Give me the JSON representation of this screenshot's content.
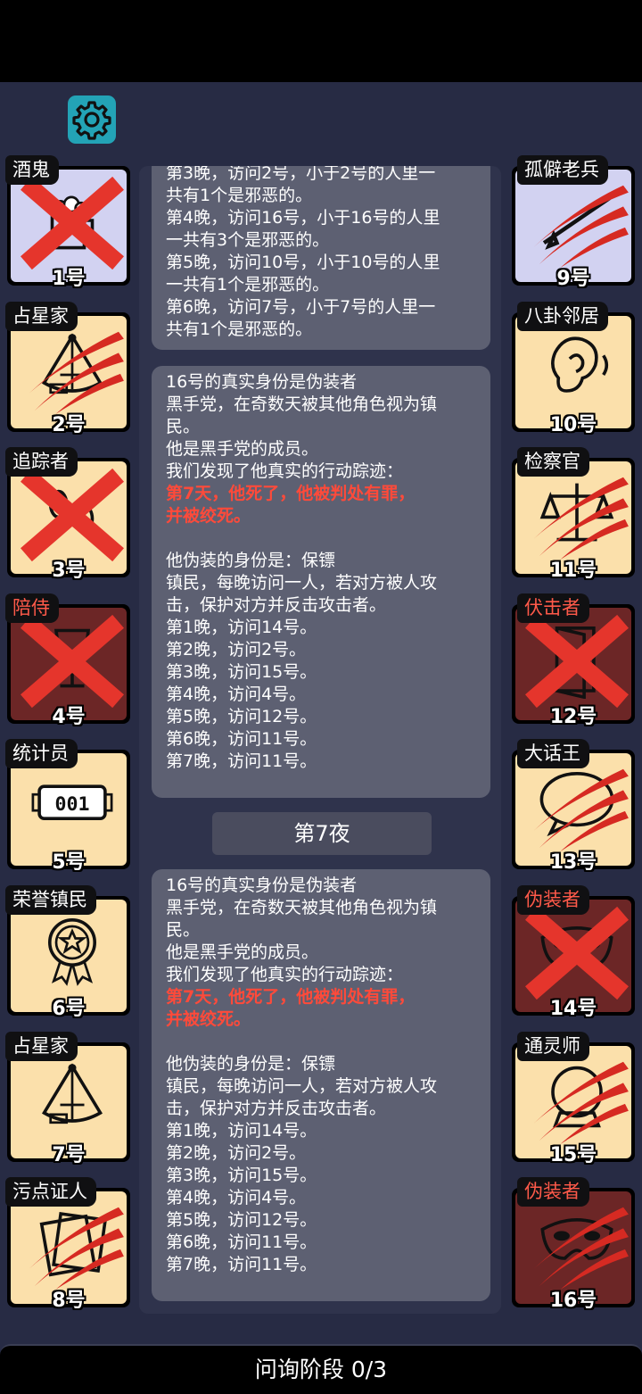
{
  "settings_icon": "gear-icon",
  "left_players": [
    {
      "role": "酒鬼",
      "num": "1号",
      "role_color": "white",
      "bg": "blue",
      "mark": "x",
      "icon": "beer-mug-icon"
    },
    {
      "role": "占星家",
      "num": "2号",
      "role_color": "white",
      "bg": "good",
      "mark": "claw",
      "icon": "sextant-icon"
    },
    {
      "role": "追踪者",
      "num": "3号",
      "role_color": "white",
      "bg": "good",
      "mark": "x",
      "icon": "footprints-icon"
    },
    {
      "role": "陪侍",
      "num": "4号",
      "role_color": "red",
      "bg": "evil",
      "mark": "x",
      "icon": "wine-glass-icon"
    },
    {
      "role": "统计员",
      "num": "5号",
      "role_color": "white",
      "bg": "good",
      "mark": "none",
      "icon": "counter-icon"
    },
    {
      "role": "荣誉镇民",
      "num": "6号",
      "role_color": "white",
      "bg": "good",
      "mark": "none",
      "icon": "medal-icon"
    },
    {
      "role": "占星家",
      "num": "7号",
      "role_color": "white",
      "bg": "good",
      "mark": "none",
      "icon": "sextant-icon"
    },
    {
      "role": "污点证人",
      "num": "8号",
      "role_color": "white",
      "bg": "good",
      "mark": "claw",
      "icon": "documents-icon"
    }
  ],
  "right_players": [
    {
      "role": "孤僻老兵",
      "num": "9号",
      "role_color": "white",
      "bg": "blue",
      "mark": "claw",
      "icon": "rifle-icon"
    },
    {
      "role": "八卦邻居",
      "num": "10号",
      "role_color": "white",
      "bg": "good",
      "mark": "none",
      "icon": "ear-icon"
    },
    {
      "role": "检察官",
      "num": "11号",
      "role_color": "white",
      "bg": "good",
      "mark": "claw",
      "icon": "scales-icon"
    },
    {
      "role": "伏击者",
      "num": "12号",
      "role_color": "red",
      "bg": "evil",
      "mark": "x",
      "icon": "door-icon"
    },
    {
      "role": "大话王",
      "num": "13号",
      "role_color": "white",
      "bg": "good",
      "mark": "claw",
      "icon": "speech-bubble-icon"
    },
    {
      "role": "伪装者",
      "num": "14号",
      "role_color": "red",
      "bg": "evil",
      "mark": "x",
      "icon": "mask-icon"
    },
    {
      "role": "通灵师",
      "num": "15号",
      "role_color": "white",
      "bg": "good",
      "mark": "claw",
      "icon": "crystal-ball-icon"
    },
    {
      "role": "伪装者",
      "num": "16号",
      "role_color": "red",
      "bg": "evil",
      "mark": "claw",
      "icon": "mask-icon"
    }
  ],
  "log": {
    "msg0": {
      "lines": [
        "第3晚，访问2号，小于2号的人里一",
        "共有1个是邪恶的。",
        "第4晚，访问16号，小于16号的人里",
        "一共有3个是邪恶的。",
        "第5晚，访问10号，小于10号的人里",
        "一共有1个是邪恶的。",
        "第6晚，访问7号，小于7号的人里一",
        "共有1个是邪恶的。"
      ]
    },
    "msg1": {
      "lines": [
        "16号的真实身份是伪装者",
        "黑手党，在奇数天被其他角色视为镇",
        "民。",
        "他是黑手党的成员。",
        "我们发现了他真实的行动踪迹："
      ],
      "alert": [
        "第7天，他死了，他被判处有罪，",
        "并被绞死。"
      ],
      "lines2": [
        "他伪装的身份是：保镖",
        "镇民，每晚访问一人，若对方被人攻",
        "击，保护对方并反击攻击者。",
        "第1晚，访问14号。",
        "第2晚，访问2号。",
        "第3晚，访问15号。",
        "第4晚，访问4号。",
        "第5晚，访问12号。",
        "第6晚，访问11号。",
        "第7晚，访问11号。"
      ]
    },
    "night_label": "第7夜",
    "msg2": {
      "lines": [
        "16号的真实身份是伪装者",
        "黑手党，在奇数天被其他角色视为镇",
        "民。",
        "他是黑手党的成员。",
        "我们发现了他真实的行动踪迹："
      ],
      "alert": [
        "第7天，他死了，他被判处有罪，",
        "并被绞死。"
      ],
      "lines2": [
        "他伪装的身份是：保镖",
        "镇民，每晚访问一人，若对方被人攻",
        "击，保护对方并反击攻击者。",
        "第1晚，访问14号。",
        "第2晚，访问2号。",
        "第3晚，访问15号。",
        "第4晚，访问4号。",
        "第5晚，访问12号。",
        "第6晚，访问11号。",
        "第7晚，访问11号。"
      ]
    }
  },
  "phase_label": "问询阶段 0/3"
}
